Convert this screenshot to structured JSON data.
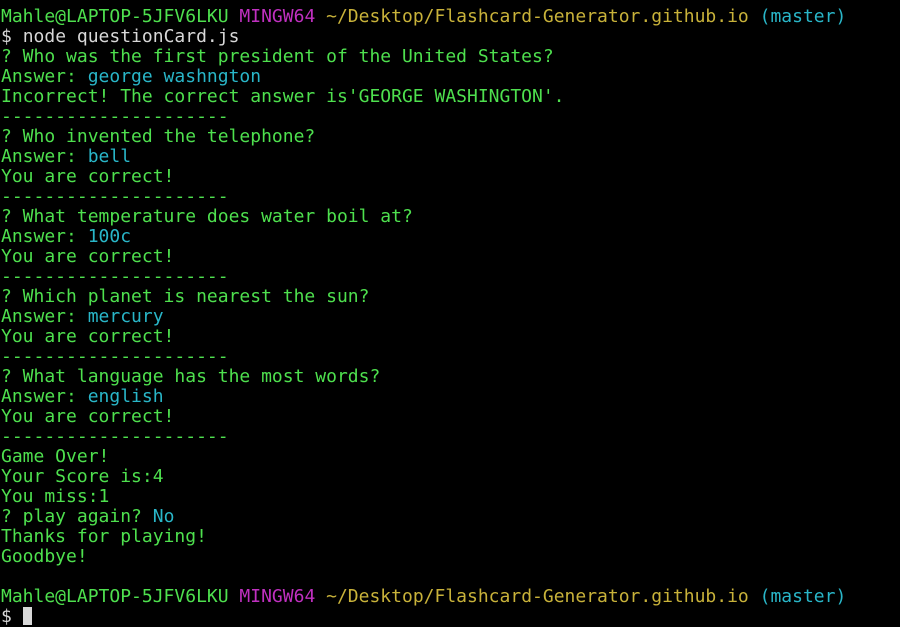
{
  "prompt": {
    "user_host": "Mahle@LAPTOP-5JFV6LKU",
    "shell": "MINGW64",
    "path": "~/Desktop/Flashcard-Generator.github.io",
    "branch": "(master)",
    "dollar": "$",
    "command": "node questionCard.js"
  },
  "qa": [
    {
      "question": "? Who was the first president of the United States?",
      "answer_label": "Answer:",
      "answer": "george washngton",
      "result": "Incorrect! The correct answer is'GEORGE WASHINGTON'."
    },
    {
      "question": "? Who invented the telephone?",
      "answer_label": "Answer:",
      "answer": "bell",
      "result": "You are correct!"
    },
    {
      "question": "? What temperature does water boil at?",
      "answer_label": "Answer:",
      "answer": "100c",
      "result": "You are correct!"
    },
    {
      "question": "? Which planet is nearest the sun?",
      "answer_label": "Answer:",
      "answer": "mercury",
      "result": "You are correct!"
    },
    {
      "question": "? What language has the most words?",
      "answer_label": "Answer:",
      "answer": "english",
      "result": "You are correct!"
    }
  ],
  "separator": "---------------------",
  "summary": {
    "game_over": "Game Over!",
    "score": "Your Score is:4",
    "miss": "You miss:1",
    "play_again_q": "? play again?",
    "play_again_a": "No",
    "thanks": "Thanks for playing!",
    "goodbye": "Goodbye!"
  },
  "colors": {
    "background": "#000000",
    "green": "#4ee04e",
    "white": "#d8d8d8",
    "cyan": "#29b6c8",
    "magenta": "#c030c0",
    "yellow": "#c8b23a"
  }
}
